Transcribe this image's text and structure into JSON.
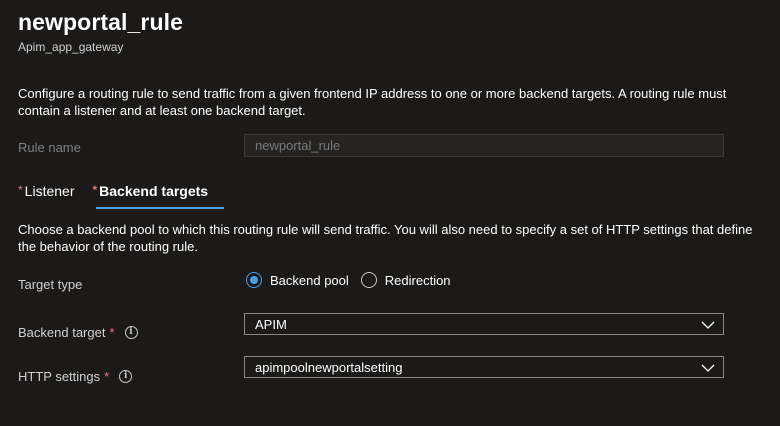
{
  "header": {
    "title": "newportal_rule",
    "subtitle": "Apim_app_gateway"
  },
  "description": "Configure a routing rule to send traffic from a given frontend IP address to one or more backend targets. A routing rule must contain a listener and at least one backend target.",
  "rule_name": {
    "label": "Rule name",
    "value": "newportal_rule"
  },
  "tabs": [
    {
      "label": "Listener",
      "required": "*"
    },
    {
      "label": "Backend targets",
      "required": "*"
    }
  ],
  "backend_description": "Choose a backend pool to which this routing rule will send traffic. You will also need to specify a set of HTTP settings that define the behavior of the routing rule.",
  "target_type": {
    "label": "Target type",
    "options": [
      "Backend pool",
      "Redirection"
    ],
    "selected": "Backend pool"
  },
  "backend_target": {
    "label": "Backend target",
    "required": "*",
    "value": "APIM"
  },
  "http_settings": {
    "label": "HTTP settings",
    "required": "*",
    "value": "apimpoolnewportalsetting"
  },
  "colors": {
    "background": "#1b1a19",
    "accent": "#4aa0e6",
    "required": "#f1707b"
  }
}
